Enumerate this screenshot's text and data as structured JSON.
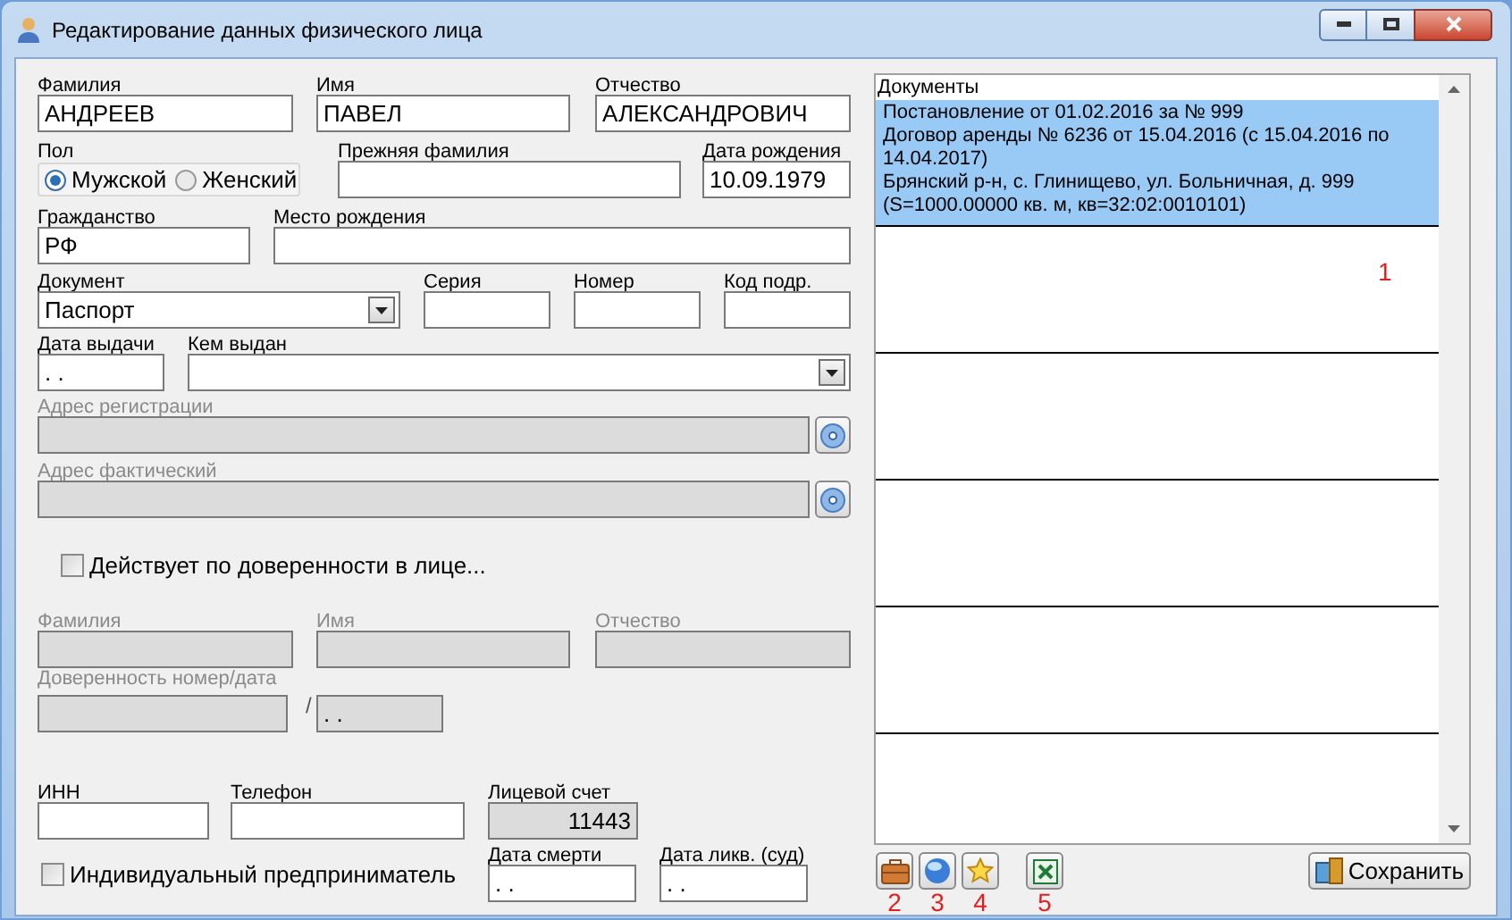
{
  "window": {
    "title": "Редактирование данных физического лица"
  },
  "form": {
    "rows": [
      [
        {
          "kind": "text",
          "label": "Фамилия",
          "value": "АНДРЕЕВ"
        },
        {
          "kind": "text",
          "label": "Имя",
          "value": "ПАВЕЛ"
        },
        {
          "kind": "text",
          "label": "Отчество",
          "value": "АЛЕКСАНДРОВИЧ"
        }
      ],
      [
        {
          "kind": "radio",
          "label": "Пол",
          "options": [
            {
              "label": "Мужской",
              "selected": true
            },
            {
              "label": "Женский",
              "selected": false
            }
          ]
        },
        {
          "kind": "text",
          "label": "Прежняя фамилия"
        },
        {
          "kind": "text",
          "label": "Дата рождения",
          "value": "10.09.1979"
        }
      ],
      [
        {
          "kind": "text",
          "label": "Гражданство",
          "value": "РФ"
        },
        {
          "kind": "text",
          "label": "Место рождения"
        }
      ],
      [
        {
          "kind": "select",
          "label": "Документ",
          "value": "Паспорт"
        },
        {
          "kind": "text",
          "label": "Серия"
        },
        {
          "kind": "text",
          "label": "Номер"
        },
        {
          "kind": "text",
          "label": "Код подр."
        }
      ],
      [
        {
          "kind": "text",
          "label": "Дата выдачи",
          "value": ". ."
        },
        {
          "kind": "select",
          "label": "Кем выдан"
        }
      ],
      [
        {
          "kind": "address",
          "label": "Адрес регистрации",
          "disabled": true
        }
      ],
      [
        {
          "kind": "address",
          "label": "Адрес фактический",
          "disabled": true
        }
      ],
      [
        {
          "kind": "checkbox",
          "label": "Действует по доверенности в лице...",
          "checked": false
        }
      ],
      [
        {
          "kind": "text",
          "label": "Фамилия",
          "disabled": true
        },
        {
          "kind": "text",
          "label": "Имя",
          "disabled": true
        },
        {
          "kind": "text",
          "label": "Отчество",
          "disabled": true
        }
      ],
      [
        {
          "kind": "text",
          "label": "Доверенность номер/дата",
          "disabled": true
        },
        {
          "kind": "separator",
          "text": "/"
        },
        {
          "kind": "text",
          "value": ". .",
          "disabled": true
        }
      ],
      [
        {
          "kind": "text",
          "label": "ИНН"
        },
        {
          "kind": "text",
          "label": "Телефон"
        },
        {
          "kind": "text",
          "label": "Лицевой счет",
          "value": "11443",
          "read_only": true
        }
      ],
      [
        {
          "kind": "checkbox",
          "label": "Индивидуальный предприниматель",
          "checked": false
        },
        {
          "kind": "text",
          "label": "Дата смерти",
          "value": ". ."
        },
        {
          "kind": "text",
          "label": "Дата ликв. (суд)",
          "value": ". ."
        }
      ]
    ]
  },
  "documents": {
    "header": "Документы",
    "annotation": "1",
    "rows": [
      {
        "selected": true,
        "lines": [
          "Постановление от 01.02.2016 за № 999",
          "Договор аренды № 6236 от 15.04.2016 (с 15.04.2016 по 14.04.2017)",
          "Брянский р-н, с. Глинищево, ул. Больничная, д. 999",
          "(S=1000.00000 кв. м, кв=32:02:0010101)"
        ]
      },
      {
        "selected": false
      },
      {
        "selected": false
      },
      {
        "selected": false
      },
      {
        "selected": false
      }
    ]
  },
  "toolbar": [
    {
      "kind": "briefcase",
      "annotation": "2"
    },
    {
      "kind": "globe",
      "annotation": "3"
    },
    {
      "kind": "star",
      "annotation": "4"
    },
    {
      "kind": "excel",
      "annotation": "5"
    }
  ],
  "save_button": {
    "label": "Сохранить"
  }
}
